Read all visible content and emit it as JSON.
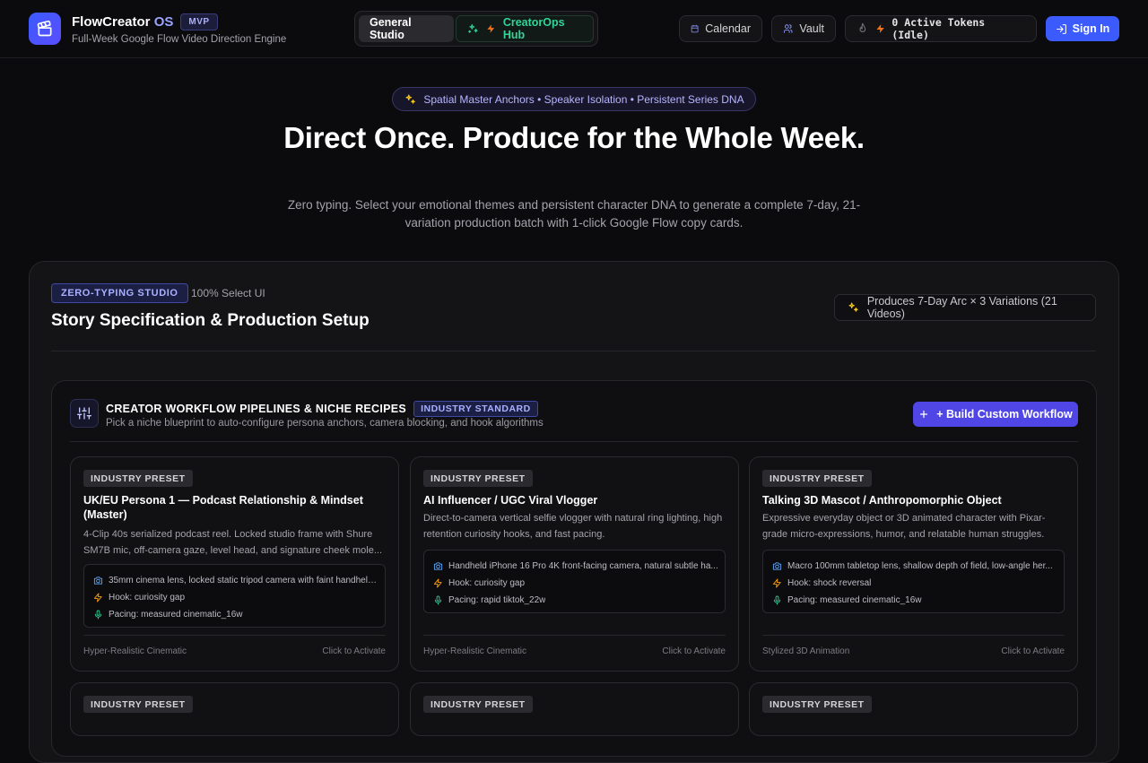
{
  "header": {
    "brand": "FlowCreator",
    "brand_os": "OS",
    "badge": "MVP",
    "tagline": "Full-Week Google Flow Video Direction Engine",
    "tabs": [
      "General Studio",
      "CreatorOps Hub"
    ],
    "calendar": "Calendar",
    "vault": "Vault",
    "tokens": "0 Active Tokens (Idle)",
    "sign_in": "Sign In"
  },
  "hero": {
    "pill": "Spatial Master Anchors • Speaker Isolation • Persistent Series DNA",
    "title": "Direct Once. Produce for the Whole Week.",
    "subtitle": "Zero typing. Select your emotional themes and persistent character DNA to generate a complete 7-day, 21-variation production batch with 1-click Google Flow copy cards."
  },
  "panel": {
    "tag": "ZERO-TYPING STUDIO",
    "select_ui": "100% Select UI",
    "title": "Story Specification & Production Setup",
    "produces": "Produces 7-Day Arc × 3 Variations (21 Videos)"
  },
  "workflows": {
    "title": "CREATOR WORKFLOW PIPELINES & NICHE RECIPES",
    "badge": "INDUSTRY STANDARD",
    "subtitle": "Pick a niche blueprint to auto-configure persona anchors, camera blocking, and hook algorithms",
    "build_button": "+ Build Custom Workflow",
    "cards": [
      {
        "preset": "INDUSTRY PRESET",
        "title": "UK/EU Persona 1 — Podcast Relationship & Mindset (Master)",
        "desc": "4-Clip 40s serialized podcast reel. Locked studio frame with Shure SM7B mic, off-camera gaze, level head, and signature cheek mole...",
        "camera": "35mm cinema lens, locked static tripod camera with faint handheld...",
        "hook": "Hook: curiosity gap",
        "pacing": "Pacing: measured cinematic_16w",
        "style": "Hyper-Realistic Cinematic",
        "activate": "Click to Activate"
      },
      {
        "preset": "INDUSTRY PRESET",
        "title": "AI Influencer / UGC Viral Vlogger",
        "desc": "Direct-to-camera vertical selfie vlogger with natural ring lighting, high retention curiosity hooks, and fast pacing.",
        "camera": "Handheld iPhone 16 Pro 4K front-facing camera, natural subtle ha...",
        "hook": "Hook: curiosity gap",
        "pacing": "Pacing: rapid tiktok_22w",
        "style": "Hyper-Realistic Cinematic",
        "activate": "Click to Activate"
      },
      {
        "preset": "INDUSTRY PRESET",
        "title": "Talking 3D Mascot / Anthropomorphic Object",
        "desc": "Expressive everyday object or 3D animated character with Pixar-grade micro-expressions, humor, and relatable human struggles.",
        "camera": "Macro 100mm tabletop lens, shallow depth of field, low-angle her...",
        "hook": "Hook: shock reversal",
        "pacing": "Pacing: measured cinematic_16w",
        "style": "Stylized 3D Animation",
        "activate": "Click to Activate"
      }
    ],
    "row2": [
      "INDUSTRY PRESET",
      "INDUSTRY PRESET",
      "INDUSTRY PRESET"
    ]
  }
}
